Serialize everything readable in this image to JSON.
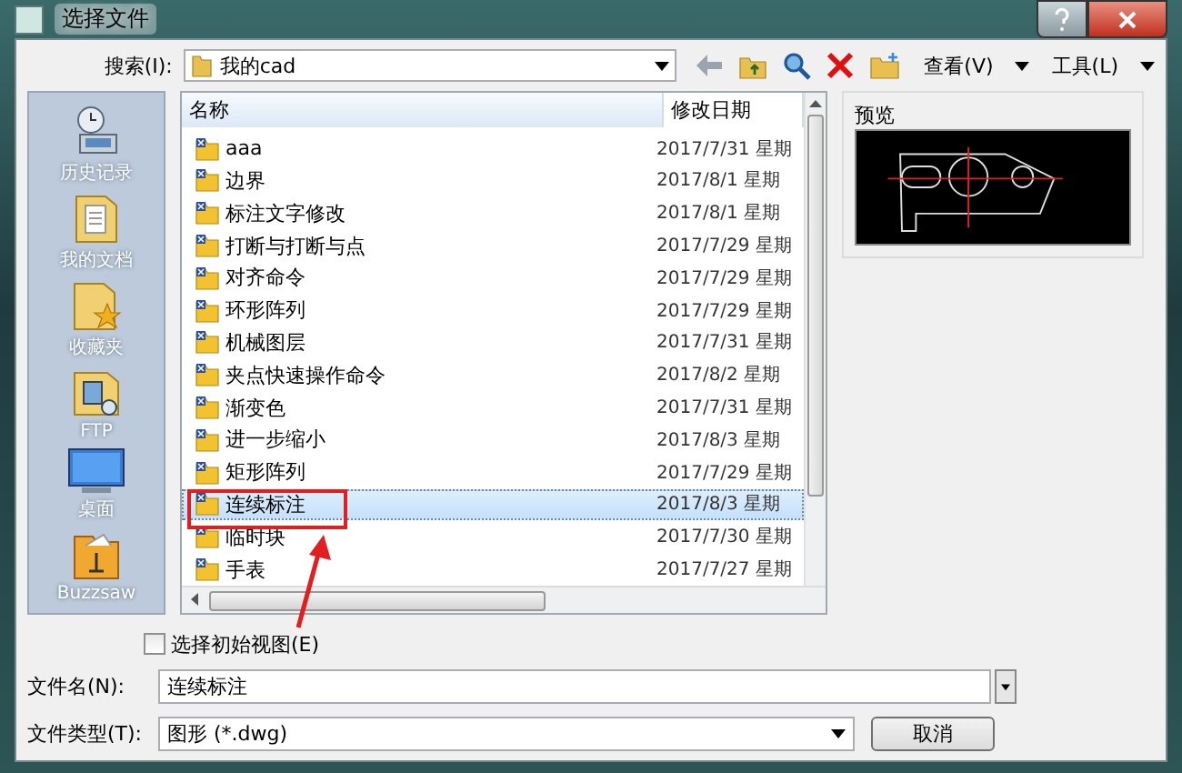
{
  "window": {
    "title": "选择文件"
  },
  "search": {
    "label": "搜索(I):",
    "value": "我的cad"
  },
  "toolbar": {
    "icons": [
      {
        "kind": "back"
      },
      {
        "kind": "up"
      },
      {
        "kind": "search"
      },
      {
        "kind": "delete"
      },
      {
        "kind": "new-folder"
      }
    ],
    "menus": [
      {
        "label": "查看(V)"
      },
      {
        "label": "工具(L)"
      }
    ]
  },
  "places": [
    {
      "kind": "history",
      "label": "历史记录"
    },
    {
      "kind": "documents",
      "label": "我的文档"
    },
    {
      "kind": "favorites",
      "label": "收藏夹"
    },
    {
      "kind": "ftp",
      "label": "FTP"
    },
    {
      "kind": "desktop",
      "label": "桌面"
    },
    {
      "kind": "buzzsaw",
      "label": "Buzzsaw"
    }
  ],
  "table": {
    "columns": [
      "名称",
      "修改日期"
    ],
    "rows": [
      {
        "name": "aaa",
        "date": "2017/7/31 星期",
        "selected": false
      },
      {
        "name": "边界",
        "date": "2017/8/1 星期",
        "selected": false
      },
      {
        "name": "标注文字修改",
        "date": "2017/8/1 星期",
        "selected": false
      },
      {
        "name": "打断与打断与点",
        "date": "2017/7/29 星期",
        "selected": false
      },
      {
        "name": "对齐命令",
        "date": "2017/7/29 星期",
        "selected": false
      },
      {
        "name": "环形阵列",
        "date": "2017/7/29 星期",
        "selected": false
      },
      {
        "name": "机械图层",
        "date": "2017/7/31 星期",
        "selected": false
      },
      {
        "name": "夹点快速操作命令",
        "date": "2017/8/2 星期",
        "selected": false
      },
      {
        "name": "渐变色",
        "date": "2017/7/31 星期",
        "selected": false
      },
      {
        "name": "进一步缩小",
        "date": "2017/8/3 星期",
        "selected": false
      },
      {
        "name": "矩形阵列",
        "date": "2017/7/29 星期",
        "selected": false
      },
      {
        "name": "连续标注",
        "date": "2017/8/3 星期",
        "selected": true
      },
      {
        "name": "临时块",
        "date": "2017/7/30 星期",
        "selected": false
      },
      {
        "name": "手表",
        "date": "2017/7/27 星期",
        "selected": false
      }
    ]
  },
  "preview": {
    "label": "预览"
  },
  "initial_view": {
    "label": "选择初始视图(E)",
    "checked": false
  },
  "file_name": {
    "label": "文件名(N):",
    "value": "连续标注"
  },
  "file_type": {
    "label": "文件类型(T):",
    "value": "图形 (*.dwg)"
  },
  "buttons": [
    {
      "label": "取消"
    }
  ]
}
